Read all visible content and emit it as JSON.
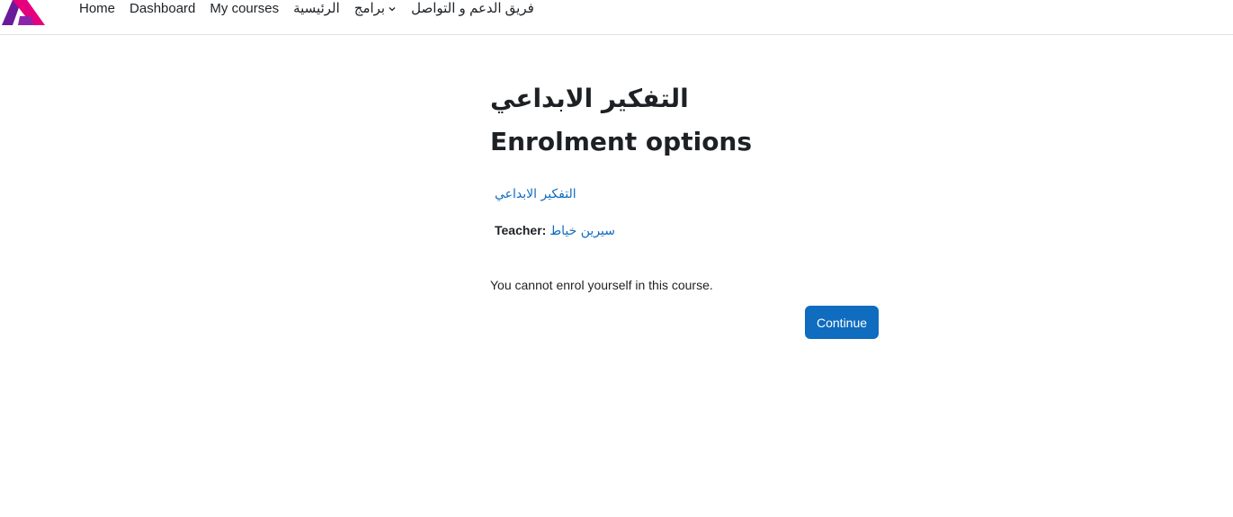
{
  "nav": {
    "items": [
      {
        "label": "Home"
      },
      {
        "label": "Dashboard"
      },
      {
        "label": "My courses"
      },
      {
        "label": "الرئيسية"
      },
      {
        "label": "برامج",
        "has_dropdown": true
      },
      {
        "label": "فريق الدعم و التواصل"
      }
    ]
  },
  "main": {
    "course_heading": "التفكير الابداعي",
    "page_title": "Enrolment options",
    "course_link": "التفكير الابداعي",
    "teacher_label": "Teacher:",
    "teacher_name": "سيرين خياط",
    "notice": "You cannot enrol yourself in this course.",
    "continue_label": "Continue"
  },
  "colors": {
    "accent": "#0f6cbf",
    "text": "#1d2125",
    "logo_purple": "#6a1b9a",
    "logo_pink": "#e6007e"
  }
}
